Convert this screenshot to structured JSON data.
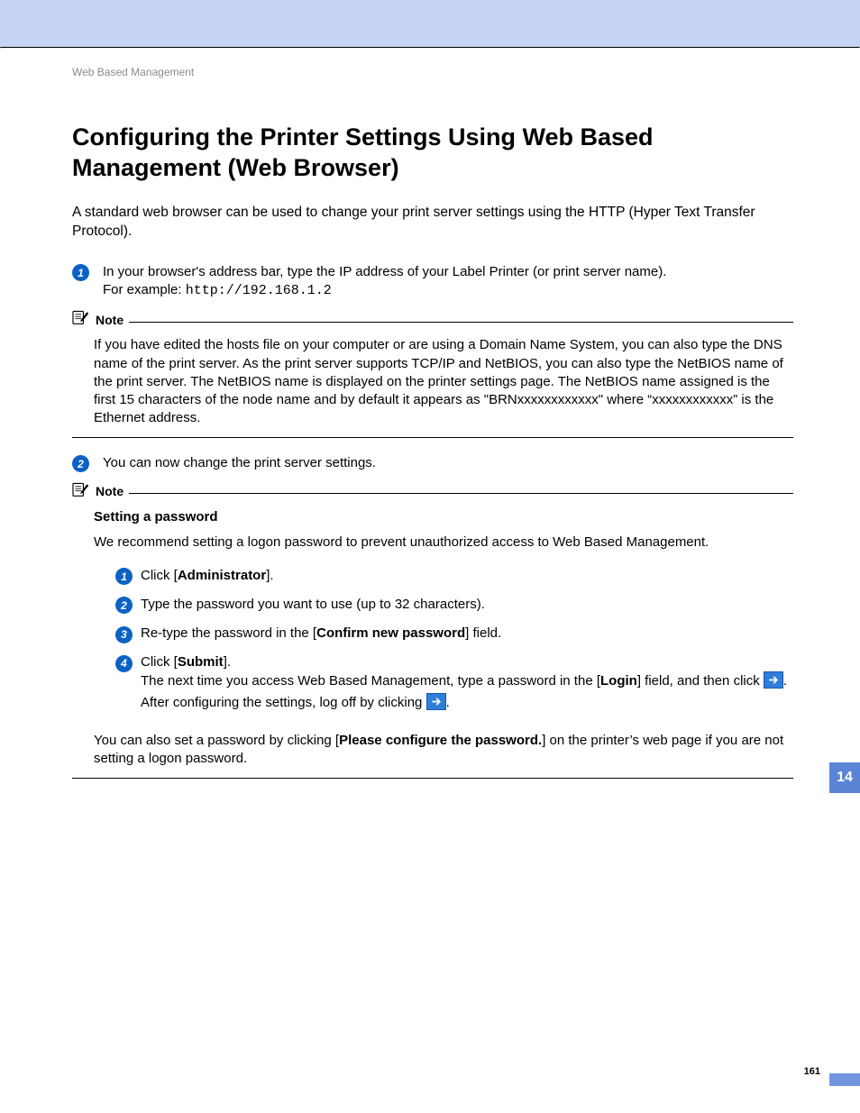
{
  "header": {
    "section_label": "Web Based Management"
  },
  "title": "Configuring the Printer Settings Using Web Based Management (Web Browser)",
  "intro": "A standard web browser can be used to change your print server settings using the HTTP (Hyper Text Transfer Protocol).",
  "step1": {
    "num": "1",
    "line1": "In your browser's address bar, type the IP address of your Label Printer (or print server name).",
    "line2_prefix": "For example: ",
    "line2_mono": "http://192.168.1.2"
  },
  "note1": {
    "label": "Note",
    "body": "If you have edited the hosts file on your computer or are using a Domain Name System, you can also type the DNS name of the print server. As the print server supports TCP/IP and NetBIOS, you can also type the NetBIOS name of the print server. The NetBIOS name is displayed on the printer settings page. The NetBIOS name assigned is the first 15 characters of the node name and by default it appears as \"BRNxxxxxxxxxxxx\" where “xxxxxxxxxxxx” is the Ethernet address."
  },
  "step2": {
    "num": "2",
    "text": "You can now change the print server settings."
  },
  "note2": {
    "label": "Note",
    "bold_heading": "Setting a password",
    "recommend": "We recommend setting a logon password to prevent unauthorized access to Web Based Management.",
    "sub1": {
      "num": "1",
      "pre": "Click [",
      "bold": "Administrator",
      "post": "]."
    },
    "sub2": {
      "num": "2",
      "text": "Type the password you want to use (up to 32 characters)."
    },
    "sub3": {
      "num": "3",
      "pre": "Re-type the password in the [",
      "bold": "Confirm new password",
      "post": "] field."
    },
    "sub4": {
      "num": "4",
      "l1_pre": "Click [",
      "l1_bold": "Submit",
      "l1_post": "].",
      "l2_pre": "The next time you access Web Based Management, type a password in the [",
      "l2_bold": "Login",
      "l2_post": "] field, and then click ",
      "l2_tail": ".",
      "l3_pre": "After configuring the settings, log off by clicking ",
      "l3_tail": "."
    },
    "closing_pre": "You can also set a password by clicking [",
    "closing_bold": "Please configure the password.",
    "closing_post": "] on the printer’s web page if you are not setting a logon password."
  },
  "side_tab": "14",
  "page_number": "161"
}
